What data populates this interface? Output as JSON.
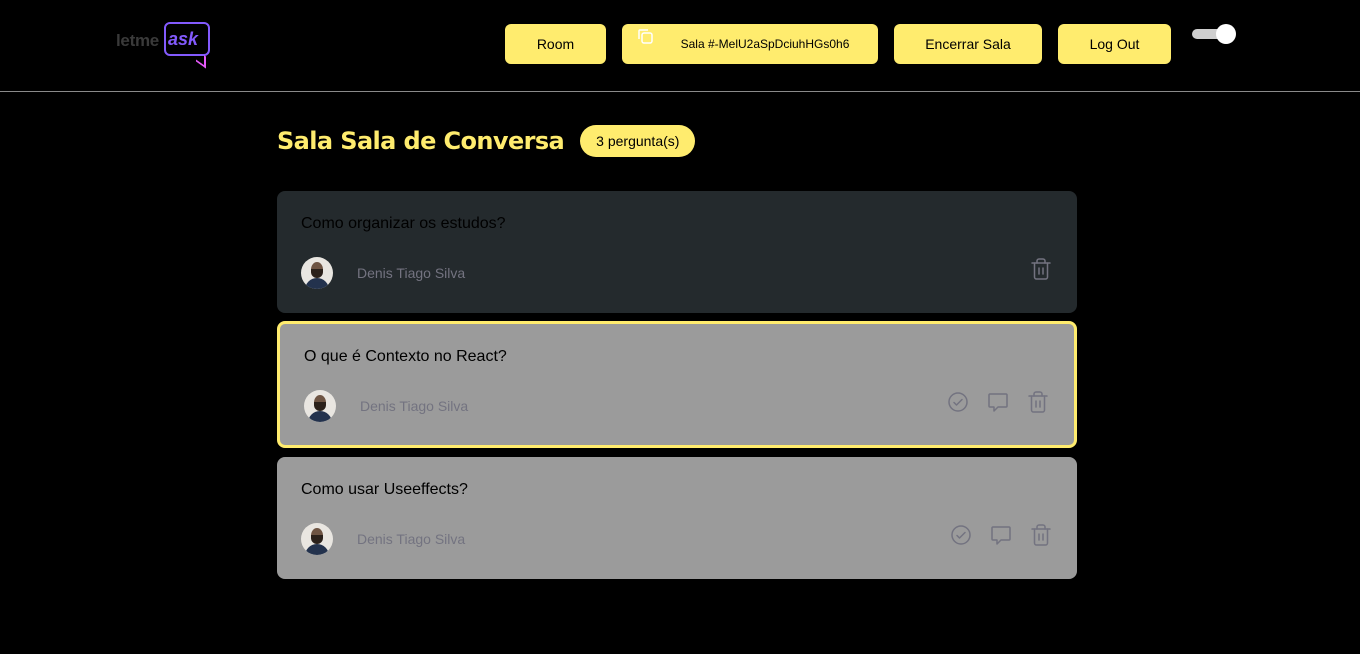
{
  "header": {
    "logo": {
      "part1": "letme",
      "part2": "ask"
    },
    "room_button": "Room",
    "room_code_button": "Sala #-MelU2aSpDciuhHGs0h6",
    "close_room_button": "Encerrar Sala",
    "logout_button": "Log Out",
    "theme_toggle": "on"
  },
  "room": {
    "title": "Sala Sala de Conversa",
    "question_count": "3 pergunta(s)"
  },
  "questions": [
    {
      "content": "Como organizar os estudos?",
      "author": "Denis Tiago Silva",
      "state": "answered",
      "actions": [
        "trash-icon"
      ]
    },
    {
      "content": "O que é Contexto no React?",
      "author": "Denis Tiago Silva",
      "state": "highlighted",
      "actions": [
        "check-circle-icon",
        "answer-bubble-icon",
        "trash-icon"
      ]
    },
    {
      "content": "Como usar Useeffects?",
      "author": "Denis Tiago Silva",
      "state": "default",
      "actions": [
        "check-circle-icon",
        "answer-bubble-icon",
        "trash-icon"
      ]
    }
  ],
  "colors": {
    "accent": "#ffec6e",
    "brand": "#835afd",
    "answered_bg": "#242a2d",
    "question_bg": "#9b9b9b",
    "author_text": "#737380"
  }
}
